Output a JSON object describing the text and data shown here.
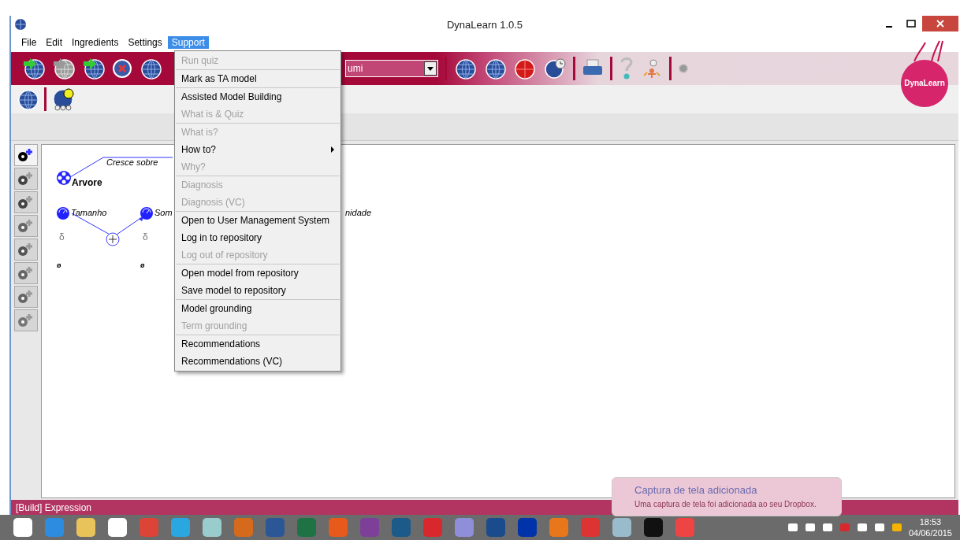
{
  "window": {
    "title": "DynaLearn 1.0.5"
  },
  "menu_bar": [
    {
      "label": "File",
      "selected": false
    },
    {
      "label": "Edit",
      "selected": false
    },
    {
      "label": "Ingredients",
      "selected": false
    },
    {
      "label": "Settings",
      "selected": false
    },
    {
      "label": "Support",
      "selected": true
    }
  ],
  "toolbar": {
    "model_selector": {
      "value": "umi"
    }
  },
  "logo": {
    "text": "DynaLearn"
  },
  "support_menu": [
    {
      "label": "Run quiz",
      "disabled": true,
      "separator_before": false,
      "submenu": false
    },
    {
      "label": "Mark as TA model",
      "disabled": false,
      "separator_before": true,
      "submenu": false
    },
    {
      "label": "Assisted Model Building",
      "disabled": false,
      "separator_before": true,
      "submenu": false
    },
    {
      "label": "What is & Quiz",
      "disabled": true,
      "separator_before": false,
      "submenu": false
    },
    {
      "label": "What is?",
      "disabled": true,
      "separator_before": true,
      "submenu": false
    },
    {
      "label": "How to?",
      "disabled": false,
      "separator_before": false,
      "submenu": true
    },
    {
      "label": "Why?",
      "disabled": true,
      "separator_before": false,
      "submenu": false
    },
    {
      "label": "Diagnosis",
      "disabled": true,
      "separator_before": true,
      "submenu": false
    },
    {
      "label": "Diagnosis (VC)",
      "disabled": true,
      "separator_before": false,
      "submenu": false
    },
    {
      "label": "Open to User Management System",
      "disabled": false,
      "separator_before": true,
      "submenu": false
    },
    {
      "label": "Log in to repository",
      "disabled": false,
      "separator_before": false,
      "submenu": false
    },
    {
      "label": "Log out of repository",
      "disabled": true,
      "separator_before": false,
      "submenu": false
    },
    {
      "label": "Open model from repository",
      "disabled": false,
      "separator_before": true,
      "submenu": false
    },
    {
      "label": "Save model to repository",
      "disabled": false,
      "separator_before": false,
      "submenu": false
    },
    {
      "label": "Model grounding",
      "disabled": false,
      "separator_before": true,
      "submenu": false
    },
    {
      "label": "Term grounding",
      "disabled": true,
      "separator_before": false,
      "submenu": false
    },
    {
      "label": "Recommendations",
      "disabled": false,
      "separator_before": true,
      "submenu": false
    },
    {
      "label": "Recommendations (VC)",
      "disabled": false,
      "separator_before": false,
      "submenu": false
    }
  ],
  "canvas": {
    "relation_label": "Cresce sobre",
    "entity": "Arvore",
    "quantities": [
      {
        "name": "Tamanho",
        "derivative": "δ",
        "value": "ø"
      },
      {
        "name": "Som",
        "derivative": "δ",
        "value": "ø"
      }
    ],
    "cut_label": "nidade"
  },
  "status_bar": {
    "text": "[Build] Expression"
  },
  "notification": {
    "title": "Captura de tela adicionada",
    "message": "Uma captura de tela foi adicionada ao seu Dropbox."
  },
  "taskbar": {
    "time": "18:53",
    "date": "04/06/2015"
  }
}
